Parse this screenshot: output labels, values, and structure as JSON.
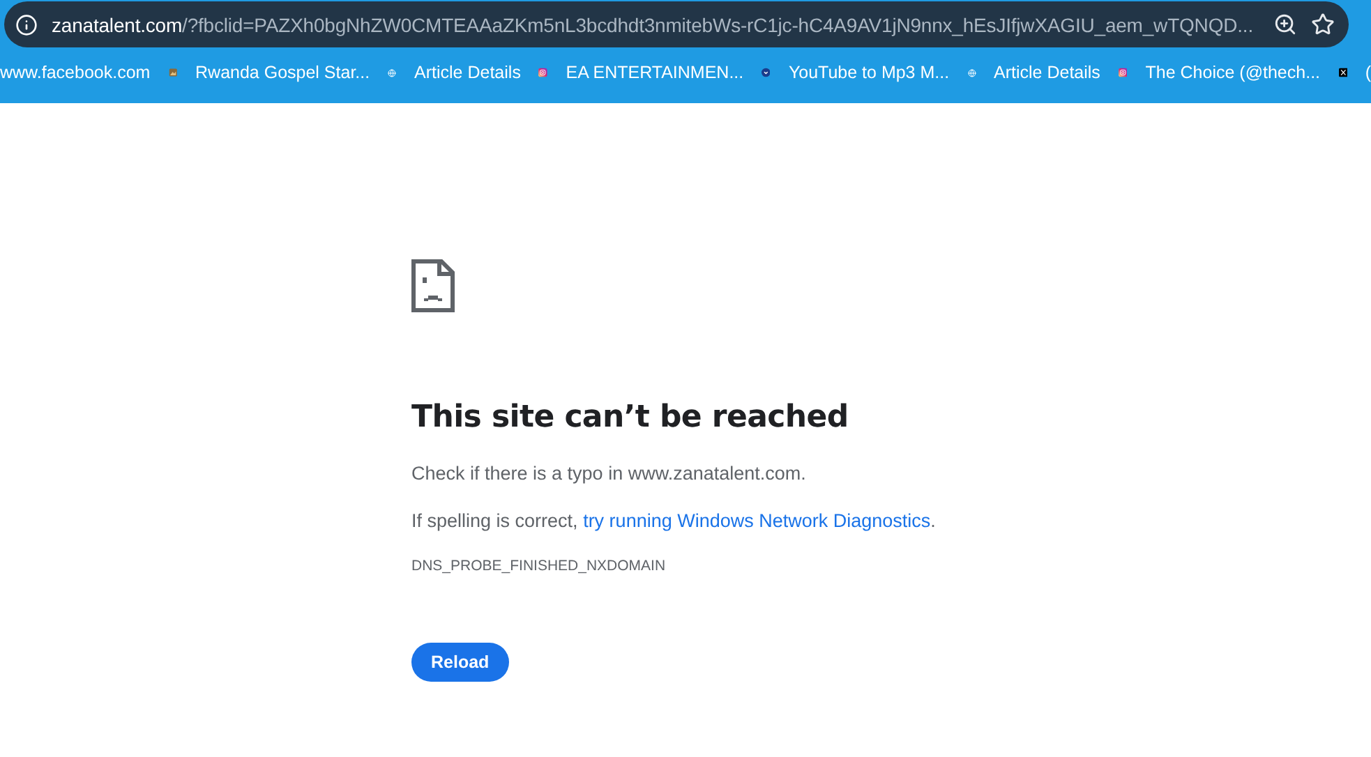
{
  "address_bar": {
    "host": "zanatalent.com",
    "path": "/?fbclid=PAZXh0bgNhZW0CMTEAAaZKm5nL3bcdhdt3nmitebWs-rC1jc-hC4A9AV1jN9nnx_hEsJIfjwXAGIU_aem_wTQNQD..."
  },
  "bookmarks": [
    {
      "kind": "plain",
      "label": "www.facebook.com"
    },
    {
      "kind": "image",
      "label": "Rwanda Gospel Star..."
    },
    {
      "kind": "globe",
      "label": "Article Details"
    },
    {
      "kind": "instagram",
      "label": "EA ENTERTAINMEN..."
    },
    {
      "kind": "chevron",
      "label": "YouTube to Mp3 M..."
    },
    {
      "kind": "globe",
      "label": "Article Details"
    },
    {
      "kind": "instagram",
      "label": "The Choice (@thech..."
    },
    {
      "kind": "x",
      "label": "("
    }
  ],
  "error": {
    "heading": "This site can’t be reached",
    "hint": "Check if there is a typo in www.zanatalent.com.",
    "suggestion": "If spelling is correct,",
    "link": "try running Windows Network Diagnostics",
    "link_end": ".",
    "code": "DNS_PROBE_FINISHED_NXDOMAIN",
    "button": "Reload"
  }
}
